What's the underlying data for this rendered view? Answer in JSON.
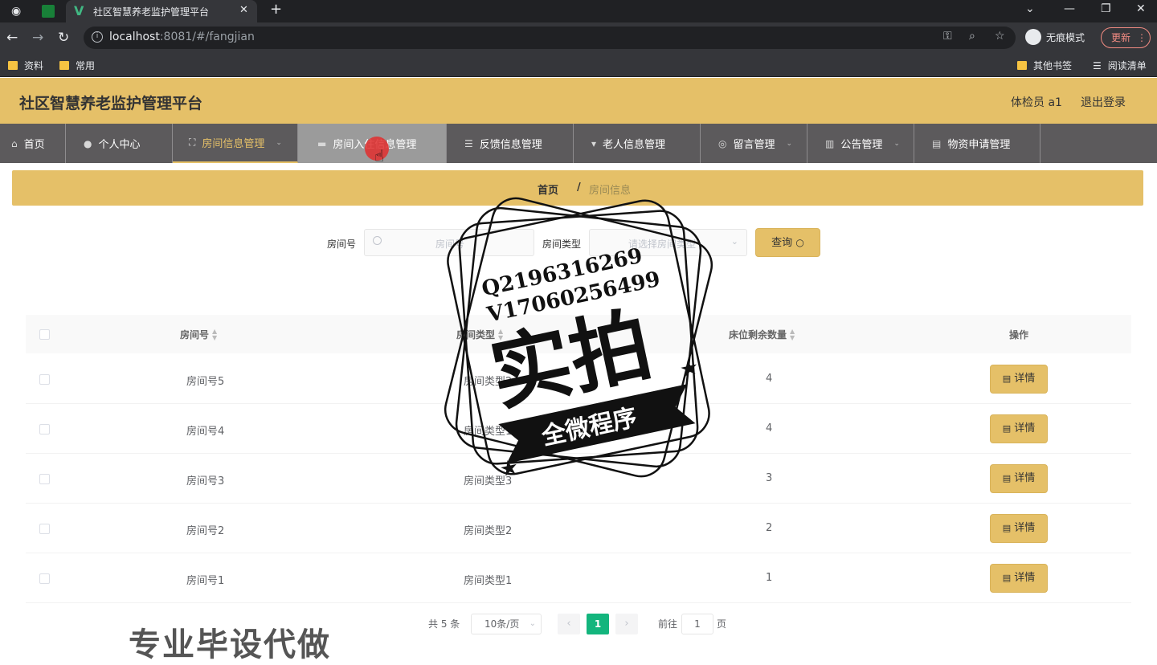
{
  "browser": {
    "tab_title": "社区智慧养老监护管理平台",
    "url_host": "localhost",
    "url_rest": ":8081/#/fangjian",
    "incognito_label": "无痕模式",
    "update_label": "更新",
    "bookmarks": [
      "资料",
      "常用"
    ],
    "bookmarks_right": [
      "其他书签",
      "阅读清单"
    ]
  },
  "app": {
    "title": "社区智慧养老监护管理平台",
    "user_role": "体检员 a1",
    "logout": "退出登录"
  },
  "menu": [
    {
      "label": "首页",
      "icon": "home-icon"
    },
    {
      "label": "个人中心",
      "icon": "user-icon"
    },
    {
      "label": "房间信息管理",
      "icon": "expand-icon"
    },
    {
      "label": "房间入住信息管理",
      "icon": "monitor-icon"
    },
    {
      "label": "反馈信息管理",
      "icon": "list-icon"
    },
    {
      "label": "老人信息管理",
      "icon": "trophy-icon"
    },
    {
      "label": "留言管理",
      "icon": "compass-icon"
    },
    {
      "label": "公告管理",
      "icon": "chart-icon"
    },
    {
      "label": "物资申请管理",
      "icon": "clipboard-icon"
    }
  ],
  "breadcrumb": {
    "home": "首页",
    "sep": "/",
    "current": "房间信息"
  },
  "search": {
    "room_no_label": "房间号",
    "room_no_placeholder": "房间号",
    "room_type_label": "房间类型",
    "room_type_placeholder": "请选择房间类型",
    "query_label": "查询"
  },
  "table": {
    "columns": [
      "房间号",
      "房间类型",
      "床位剩余数量",
      "操作"
    ],
    "detail_label": "详情",
    "rows": [
      {
        "room_no": "房间号5",
        "room_type": "房间类型2",
        "beds_left": "4"
      },
      {
        "room_no": "房间号4",
        "room_type": "房间类型1",
        "beds_left": "4"
      },
      {
        "room_no": "房间号3",
        "room_type": "房间类型3",
        "beds_left": "3"
      },
      {
        "room_no": "房间号2",
        "room_type": "房间类型2",
        "beds_left": "2"
      },
      {
        "room_no": "房间号1",
        "room_type": "房间类型1",
        "beds_left": "1"
      }
    ]
  },
  "pagination": {
    "total": "共 5 条",
    "page_size": "10条/页",
    "current": "1",
    "goto_label": "前往",
    "goto_value": "1",
    "page_label": "页"
  },
  "watermark": {
    "line1": "Q2196316269",
    "line2": "V17060256499",
    "big": "实拍",
    "banner": "全微程序",
    "bottom": "专业毕设代做"
  },
  "colors": {
    "accent": "#e5c068",
    "menu_bg": "#5c5a5c",
    "pager_active": "#13b57d"
  }
}
